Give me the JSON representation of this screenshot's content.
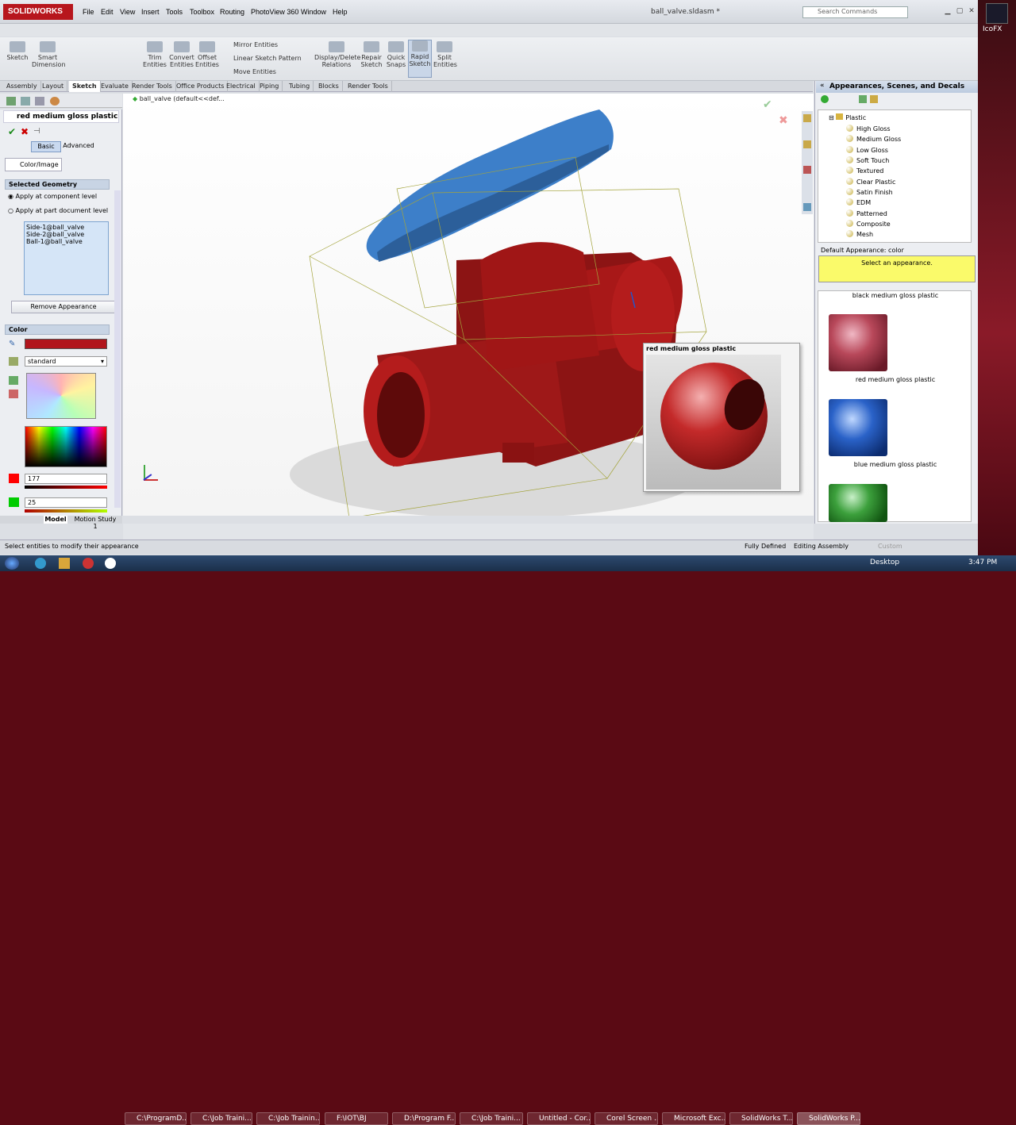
{
  "app": {
    "logo": "SOLIDWORKS",
    "doc_title": "ball_valve.sldasm *",
    "search_placeholder": "Search Commands"
  },
  "menu": [
    "File",
    "Edit",
    "View",
    "Insert",
    "Tools",
    "Toolbox",
    "Routing",
    "PhotoView 360",
    "Window",
    "Help"
  ],
  "ribbon": [
    "Sketch",
    "Smart Dimension",
    "Trim Entities",
    "Convert Entities",
    "Offset Entities",
    "Mirror Entities",
    "Linear Sketch Pattern",
    "Move Entities",
    "Display/Delete Relations",
    "Repair Sketch",
    "Quick Snaps",
    "Rapid Sketch",
    "Split Entities"
  ],
  "tabs": [
    "Assembly",
    "Layout",
    "Sketch",
    "Evaluate",
    "Render Tools",
    "Office Products",
    "Electrical",
    "Piping",
    "Tubing",
    "Blocks",
    "Render Tools"
  ],
  "left": {
    "title": "red medium gloss plastic",
    "basic": "Basic",
    "advanced": "Advanced",
    "colorimage": "Color/Image",
    "selected_geometry": "Selected Geometry",
    "apply_component": "Apply at component level",
    "apply_part": "Apply at part document level",
    "geometry": [
      "Side-1@ball_valve",
      "Side-2@ball_valve",
      "Ball-1@ball_valve"
    ],
    "remove": "Remove Appearance",
    "color_hdr": "Color",
    "dropdown": "standard",
    "red_value": "177",
    "green_value": "25",
    "swatch_color": "#b1151c"
  },
  "viewport": {
    "tree_label": "ball_valve  (default<<def..."
  },
  "bottomtabs": {
    "model": "Model",
    "motion": "Motion Study 1"
  },
  "status": {
    "hint": "Select entities to modify their appearance",
    "defined": "Fully Defined",
    "mode": "Editing Assembly",
    "custom": "Custom"
  },
  "right": {
    "title": "Appearances, Scenes, and Decals",
    "tree_root": "Plastic",
    "tree": [
      "High Gloss",
      "Medium Gloss",
      "Low Gloss",
      "Soft Touch",
      "Textured",
      "Clear Plastic",
      "Satin Finish",
      "EDM",
      "Patterned",
      "Composite",
      "Mesh"
    ],
    "default_appearance": "Default Appearance: color",
    "select_msg": "Select an appearance.",
    "swatches": [
      {
        "label": "black medium gloss plastic"
      },
      {
        "label": "red medium gloss plastic"
      },
      {
        "label": "blue medium gloss plastic"
      }
    ]
  },
  "tooltip": {
    "title": "red medium gloss plastic"
  },
  "taskbar": {
    "desktop": "Desktop",
    "clock": "3:47 PM",
    "items": [
      "C:\\ProgramD...",
      "C:\\Job Traini...",
      "C:\\Job Trainin...",
      "F:\\IOT\\BJ",
      "D:\\Program F...",
      "C:\\Job Traini...",
      "Untitled - Cor...",
      "Corel Screen ...",
      "Microsoft Exc...",
      "SolidWorks T...",
      "SolidWorks P..."
    ]
  },
  "desktop_icon": "IcoFX"
}
